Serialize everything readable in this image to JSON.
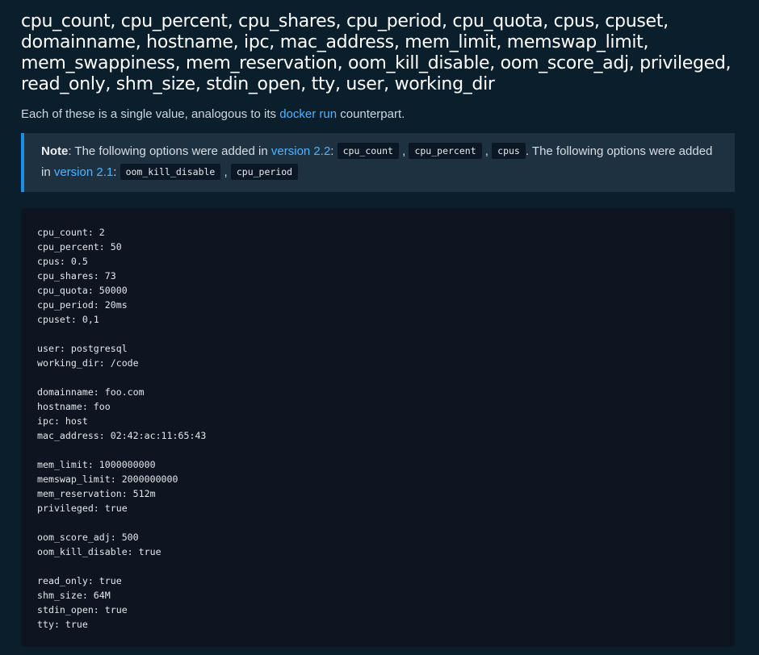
{
  "heading": "cpu_count, cpu_percent, cpu_shares, cpu_period, cpu_quota, cpus, cpuset, domainname, hostname, ipc, mac_address, mem_limit, memswap_limit, mem_swappiness, mem_reservation, oom_kill_disable, oom_score_adj, privileged, read_only, shm_size, stdin_open, tty, user, working_dir",
  "intro": {
    "before": "Each of these is a single value, analogous to its ",
    "link": "docker run",
    "after": " counterpart."
  },
  "note": {
    "label": "Note",
    "text1": ": The following options were added in ",
    "version1": "version 2.2",
    "colon1": ": ",
    "codes1": [
      "cpu_count",
      "cpu_percent",
      "cpus"
    ],
    "sep": " , ",
    "text2": ". The following options were added in ",
    "version2": "version 2.1",
    "colon2": ": ",
    "codes2": [
      "oom_kill_disable",
      "cpu_period"
    ]
  },
  "code_lines": [
    "cpu_count: 2",
    "cpu_percent: 50",
    "cpus: 0.5",
    "cpu_shares: 73",
    "cpu_quota: 50000",
    "cpu_period: 20ms",
    "cpuset: 0,1",
    "",
    "user: postgresql",
    "working_dir: /code",
    "",
    "domainname: foo.com",
    "hostname: foo",
    "ipc: host",
    "mac_address: 02:42:ac:11:65:43",
    "",
    "mem_limit: 1000000000",
    "memswap_limit: 2000000000",
    "mem_reservation: 512m",
    "privileged: true",
    "",
    "oom_score_adj: 500",
    "oom_kill_disable: true",
    "",
    "read_only: true",
    "shm_size: 64M",
    "stdin_open: true",
    "tty: true"
  ]
}
